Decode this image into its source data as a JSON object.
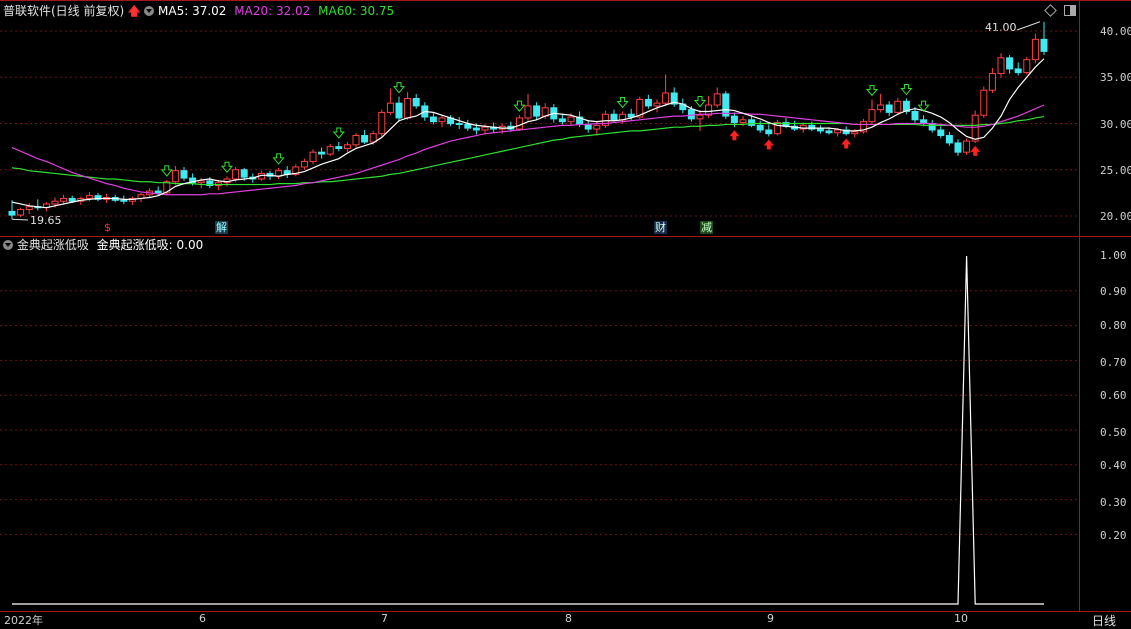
{
  "title": "普联软件(日线 前复权)",
  "ma": [
    {
      "label": "MA5: 37.02",
      "color": "#ffffff"
    },
    {
      "label": "MA20: 32.02",
      "color": "#e040e0"
    },
    {
      "label": "MA60: 30.75",
      "color": "#30e030"
    }
  ],
  "indicator": {
    "name": "金典起涨低吸",
    "value_label": "金典起涨低吸: 0.00"
  },
  "price_axis": [
    "40.00",
    "35.00",
    "30.00",
    "25.00",
    "20.00"
  ],
  "indicator_axis": [
    "1.00",
    "0.90",
    "0.80",
    "0.70",
    "0.60",
    "0.50",
    "0.40",
    "0.30",
    "0.20"
  ],
  "x_axis": [
    "2022年",
    "6",
    "7",
    "8",
    "9",
    "10"
  ],
  "period_label": "日线",
  "max_price_label": "41.00",
  "min_price_label": "19.65",
  "events": [
    {
      "label": "$",
      "color": "#ff3030",
      "bg": ""
    },
    {
      "label": "解",
      "color": "#9ff",
      "bg": "#1a3a4a"
    },
    {
      "label": "财",
      "color": "#cfe",
      "bg": "#1a2a4a"
    },
    {
      "label": "减",
      "color": "#cfc",
      "bg": "#1a4a1a"
    }
  ],
  "colors": {
    "up": "#ff4040",
    "down": "#40e8f0",
    "grid": "#6a1515",
    "frame": "#a01818"
  },
  "chart_data": [
    {
      "type": "candlestick",
      "title": "普联软件(日线 前复权)",
      "ylim": [
        18.5,
        42
      ],
      "ohlc": [
        [
          20.5,
          21.7,
          19.65,
          20.1
        ],
        [
          20.1,
          20.9,
          19.9,
          20.7
        ],
        [
          20.7,
          21.4,
          20.2,
          21.0
        ],
        [
          21.0,
          21.8,
          20.6,
          20.9
        ],
        [
          20.9,
          21.5,
          20.5,
          21.3
        ],
        [
          21.3,
          22.0,
          20.9,
          21.6
        ],
        [
          21.6,
          22.3,
          21.2,
          21.9
        ],
        [
          21.9,
          22.2,
          21.4,
          21.6
        ],
        [
          21.6,
          22.1,
          21.2,
          21.9
        ],
        [
          21.9,
          22.6,
          21.6,
          22.2
        ],
        [
          22.2,
          22.5,
          21.6,
          21.8
        ],
        [
          21.8,
          22.4,
          21.4,
          22.0
        ],
        [
          22.0,
          22.3,
          21.5,
          21.7
        ],
        [
          21.7,
          22.2,
          21.3,
          21.6
        ],
        [
          21.6,
          22.1,
          21.2,
          21.9
        ],
        [
          21.9,
          22.5,
          21.5,
          22.3
        ],
        [
          22.3,
          23.0,
          22.0,
          22.7
        ],
        [
          22.7,
          23.2,
          22.2,
          22.5
        ],
        [
          22.5,
          23.9,
          22.3,
          23.7
        ],
        [
          23.7,
          25.4,
          23.4,
          24.9
        ],
        [
          24.9,
          25.3,
          23.8,
          24.1
        ],
        [
          24.1,
          24.6,
          23.3,
          23.6
        ],
        [
          23.6,
          24.1,
          23.0,
          23.8
        ],
        [
          23.8,
          24.2,
          23.0,
          23.3
        ],
        [
          23.3,
          23.9,
          22.8,
          23.6
        ],
        [
          23.6,
          24.3,
          23.2,
          24.0
        ],
        [
          24.0,
          25.3,
          23.7,
          25.0
        ],
        [
          25.0,
          25.2,
          23.8,
          24.2
        ],
        [
          24.2,
          24.6,
          23.6,
          24.0
        ],
        [
          24.0,
          24.9,
          23.8,
          24.6
        ],
        [
          24.6,
          24.9,
          23.9,
          24.3
        ],
        [
          24.3,
          25.2,
          24.0,
          24.9
        ],
        [
          24.9,
          25.4,
          24.1,
          24.5
        ],
        [
          24.5,
          25.6,
          24.3,
          25.3
        ],
        [
          25.3,
          26.2,
          25.0,
          25.9
        ],
        [
          25.9,
          27.2,
          25.6,
          26.9
        ],
        [
          26.9,
          27.4,
          26.2,
          26.7
        ],
        [
          26.7,
          27.8,
          26.5,
          27.5
        ],
        [
          27.5,
          28.0,
          27.0,
          27.3
        ],
        [
          27.3,
          28.0,
          26.9,
          27.7
        ],
        [
          27.7,
          29.0,
          27.4,
          28.7
        ],
        [
          28.7,
          29.3,
          27.8,
          28.0
        ],
        [
          28.0,
          29.2,
          27.7,
          28.9
        ],
        [
          28.9,
          31.5,
          28.6,
          31.2
        ],
        [
          31.2,
          33.8,
          30.9,
          32.2
        ],
        [
          32.2,
          32.9,
          30.2,
          30.6
        ],
        [
          30.6,
          33.4,
          30.4,
          32.7
        ],
        [
          32.7,
          33.2,
          31.6,
          31.9
        ],
        [
          31.9,
          32.3,
          30.3,
          30.7
        ],
        [
          30.7,
          31.2,
          29.9,
          30.2
        ],
        [
          30.2,
          30.9,
          29.6,
          30.6
        ],
        [
          30.6,
          30.9,
          29.7,
          30.0
        ],
        [
          30.0,
          30.7,
          29.4,
          29.9
        ],
        [
          29.9,
          30.4,
          29.2,
          29.5
        ],
        [
          29.5,
          30.0,
          28.8,
          29.3
        ],
        [
          29.3,
          29.9,
          28.8,
          29.6
        ],
        [
          29.6,
          30.1,
          29.0,
          29.4
        ],
        [
          29.4,
          30.0,
          28.9,
          29.7
        ],
        [
          29.7,
          30.2,
          29.1,
          29.4
        ],
        [
          29.4,
          30.9,
          29.2,
          30.6
        ],
        [
          30.6,
          33.2,
          30.3,
          31.9
        ],
        [
          31.9,
          32.3,
          30.4,
          30.8
        ],
        [
          30.8,
          32.2,
          30.5,
          31.7
        ],
        [
          31.7,
          32.1,
          30.1,
          30.5
        ],
        [
          30.5,
          31.0,
          29.9,
          30.2
        ],
        [
          30.2,
          31.1,
          29.8,
          30.7
        ],
        [
          30.7,
          31.3,
          29.6,
          29.9
        ],
        [
          29.9,
          30.4,
          29.0,
          29.4
        ],
        [
          29.4,
          30.2,
          28.7,
          29.8
        ],
        [
          29.8,
          31.4,
          29.5,
          31.0
        ],
        [
          31.0,
          31.5,
          30.2,
          30.4
        ],
        [
          30.4,
          31.3,
          30.0,
          31.0
        ],
        [
          31.0,
          31.6,
          30.4,
          30.7
        ],
        [
          30.7,
          32.9,
          30.5,
          32.6
        ],
        [
          32.6,
          33.1,
          31.6,
          31.9
        ],
        [
          31.9,
          32.6,
          31.2,
          32.2
        ],
        [
          32.2,
          35.3,
          31.9,
          33.3
        ],
        [
          33.3,
          33.9,
          31.8,
          32.1
        ],
        [
          32.1,
          32.7,
          31.1,
          31.5
        ],
        [
          31.5,
          31.9,
          30.2,
          30.5
        ],
        [
          30.5,
          31.4,
          29.2,
          30.9
        ],
        [
          30.9,
          33.0,
          30.6,
          32.0
        ],
        [
          32.0,
          33.9,
          31.7,
          33.2
        ],
        [
          33.2,
          33.5,
          30.5,
          30.8
        ],
        [
          30.8,
          31.2,
          29.6,
          30.1
        ],
        [
          30.1,
          30.8,
          29.7,
          30.4
        ],
        [
          30.4,
          30.9,
          29.6,
          29.8
        ],
        [
          29.8,
          30.3,
          29.0,
          29.3
        ],
        [
          29.3,
          29.9,
          28.6,
          28.9
        ],
        [
          28.9,
          30.4,
          28.7,
          30.1
        ],
        [
          30.1,
          30.6,
          29.5,
          29.7
        ],
        [
          29.7,
          30.3,
          29.2,
          29.4
        ],
        [
          29.4,
          30.1,
          29.0,
          29.8
        ],
        [
          29.8,
          30.2,
          29.2,
          29.4
        ],
        [
          29.4,
          29.8,
          28.9,
          29.2
        ],
        [
          29.2,
          29.6,
          28.8,
          29.0
        ],
        [
          29.0,
          29.5,
          28.6,
          29.3
        ],
        [
          29.3,
          29.7,
          28.7,
          28.9
        ],
        [
          28.9,
          29.4,
          28.5,
          29.1
        ],
        [
          29.1,
          30.5,
          28.9,
          30.2
        ],
        [
          30.2,
          32.6,
          30.0,
          31.5
        ],
        [
          31.5,
          33.2,
          31.2,
          32.0
        ],
        [
          32.0,
          32.4,
          30.8,
          31.2
        ],
        [
          31.2,
          32.8,
          31.0,
          32.4
        ],
        [
          32.4,
          32.7,
          31.0,
          31.3
        ],
        [
          31.3,
          31.8,
          30.1,
          30.4
        ],
        [
          30.4,
          30.9,
          29.7,
          30.0
        ],
        [
          30.0,
          30.4,
          29.0,
          29.3
        ],
        [
          29.3,
          29.7,
          28.4,
          28.7
        ],
        [
          28.7,
          29.1,
          27.6,
          27.9
        ],
        [
          27.9,
          28.3,
          26.5,
          26.9
        ],
        [
          26.9,
          28.4,
          26.6,
          28.1
        ],
        [
          28.1,
          31.4,
          27.9,
          30.9
        ],
        [
          30.9,
          34.0,
          30.6,
          33.6
        ],
        [
          33.6,
          36.0,
          33.3,
          35.4
        ],
        [
          35.4,
          37.6,
          35.0,
          37.1
        ],
        [
          37.1,
          37.4,
          35.4,
          35.9
        ],
        [
          35.9,
          36.6,
          35.2,
          35.5
        ],
        [
          35.5,
          37.2,
          35.3,
          36.9
        ],
        [
          36.9,
          39.7,
          36.5,
          39.1
        ],
        [
          39.1,
          41.0,
          37.4,
          37.8
        ]
      ],
      "ma5": [
        21.5,
        21.3,
        21.1,
        21.0,
        20.9,
        21.1,
        21.3,
        21.5,
        21.7,
        21.8,
        21.9,
        21.9,
        21.9,
        21.8,
        21.8,
        21.9,
        22.0,
        22.2,
        22.6,
        23.2,
        23.5,
        23.7,
        23.9,
        24.0,
        23.8,
        23.7,
        23.9,
        24.0,
        24.1,
        24.4,
        24.4,
        24.3,
        24.5,
        24.6,
        24.8,
        25.2,
        25.6,
        25.9,
        26.2,
        26.8,
        27.3,
        27.6,
        27.9,
        28.5,
        29.4,
        30.3,
        30.6,
        30.8,
        31.3,
        31.2,
        30.9,
        30.6,
        30.3,
        30.0,
        29.8,
        29.7,
        29.6,
        29.5,
        29.5,
        29.8,
        30.2,
        30.4,
        30.8,
        31.1,
        31.0,
        30.9,
        30.6,
        30.3,
        30.2,
        30.3,
        30.3,
        30.4,
        30.6,
        30.9,
        31.3,
        31.7,
        32.0,
        32.3,
        32.1,
        31.6,
        31.3,
        31.3,
        31.4,
        31.5,
        31.4,
        31.1,
        30.8,
        30.5,
        30.1,
        29.8,
        29.7,
        29.6,
        29.5,
        29.5,
        29.5,
        29.5,
        29.4,
        29.2,
        29.2,
        29.3,
        29.6,
        30.1,
        30.5,
        31.0,
        31.4,
        31.6,
        31.4,
        31.1,
        30.7,
        30.1,
        29.3,
        28.6,
        28.3,
        28.5,
        29.5,
        30.8,
        32.6,
        33.9,
        35.0,
        36.1,
        37.0
      ],
      "ma20": [
        27.4,
        27.0,
        26.6,
        26.2,
        25.9,
        25.5,
        25.1,
        24.7,
        24.4,
        24.1,
        23.8,
        23.5,
        23.3,
        23.0,
        22.8,
        22.6,
        22.5,
        22.4,
        22.3,
        22.3,
        22.3,
        22.3,
        22.3,
        22.4,
        22.4,
        22.5,
        22.6,
        22.7,
        22.8,
        22.9,
        23.0,
        23.1,
        23.2,
        23.3,
        23.5,
        23.6,
        23.8,
        24.0,
        24.2,
        24.4,
        24.6,
        24.9,
        25.2,
        25.5,
        25.8,
        26.1,
        26.5,
        26.8,
        27.2,
        27.5,
        27.8,
        28.1,
        28.3,
        28.5,
        28.7,
        28.9,
        29.0,
        29.1,
        29.2,
        29.3,
        29.4,
        29.5,
        29.6,
        29.7,
        29.8,
        29.8,
        29.9,
        29.9,
        30.0,
        30.0,
        30.1,
        30.2,
        30.3,
        30.4,
        30.5,
        30.6,
        30.7,
        30.8,
        30.8,
        30.9,
        31.0,
        31.0,
        31.1,
        31.1,
        31.1,
        31.1,
        31.0,
        31.0,
        30.9,
        30.8,
        30.7,
        30.6,
        30.5,
        30.4,
        30.3,
        30.2,
        30.1,
        30.0,
        29.9,
        29.9,
        29.9,
        29.9,
        29.9,
        30.0,
        30.0,
        30.0,
        30.0,
        30.0,
        29.9,
        29.8,
        29.7,
        29.6,
        29.6,
        29.7,
        29.9,
        30.2,
        30.5,
        30.8,
        31.2,
        31.6,
        32.0
      ],
      "ma60": [
        25.2,
        25.1,
        24.9,
        24.8,
        24.7,
        24.6,
        24.5,
        24.4,
        24.3,
        24.2,
        24.1,
        24.0,
        24.0,
        23.9,
        23.8,
        23.7,
        23.7,
        23.6,
        23.6,
        23.5,
        23.5,
        23.5,
        23.4,
        23.4,
        23.4,
        23.4,
        23.4,
        23.4,
        23.4,
        23.4,
        23.4,
        23.5,
        23.5,
        23.5,
        23.6,
        23.6,
        23.7,
        23.7,
        23.8,
        23.9,
        24.0,
        24.1,
        24.2,
        24.3,
        24.5,
        24.6,
        24.8,
        25.0,
        25.2,
        25.4,
        25.6,
        25.8,
        26.0,
        26.2,
        26.4,
        26.6,
        26.8,
        27.0,
        27.2,
        27.4,
        27.6,
        27.8,
        28.0,
        28.2,
        28.3,
        28.5,
        28.6,
        28.7,
        28.8,
        28.9,
        29.0,
        29.1,
        29.2,
        29.2,
        29.3,
        29.4,
        29.5,
        29.6,
        29.6,
        29.7,
        29.7,
        29.8,
        29.8,
        29.9,
        29.9,
        29.9,
        30.0,
        30.0,
        30.0,
        30.0,
        30.0,
        30.0,
        30.0,
        30.0,
        30.0,
        30.0,
        30.0,
        30.0,
        29.9,
        29.9,
        29.9,
        29.9,
        29.9,
        29.9,
        29.9,
        29.9,
        29.8,
        29.8,
        29.8,
        29.8,
        29.8,
        29.8,
        29.8,
        29.9,
        29.9,
        30.0,
        30.1,
        30.3,
        30.4,
        30.6,
        30.75
      ]
    },
    {
      "type": "line",
      "title": "金典起涨低吸",
      "ylim": [
        0,
        1
      ],
      "values": [
        0,
        0,
        0,
        0,
        0,
        0,
        0,
        0,
        0,
        0,
        0,
        0,
        0,
        0,
        0,
        0,
        0,
        0,
        0,
        0,
        0,
        0,
        0,
        0,
        0,
        0,
        0,
        0,
        0,
        0,
        0,
        0,
        0,
        0,
        0,
        0,
        0,
        0,
        0,
        0,
        0,
        0,
        0,
        0,
        0,
        0,
        0,
        0,
        0,
        0,
        0,
        0,
        0,
        0,
        0,
        0,
        0,
        0,
        0,
        0,
        0,
        0,
        0,
        0,
        0,
        0,
        0,
        0,
        0,
        0,
        0,
        0,
        0,
        0,
        0,
        0,
        0,
        0,
        0,
        0,
        0,
        0,
        0,
        0,
        0,
        0,
        0,
        0,
        0,
        0,
        0,
        0,
        0,
        0,
        0,
        0,
        0,
        0,
        0,
        0,
        0,
        0,
        0,
        0,
        0,
        0,
        0,
        0,
        0,
        0,
        0,
        1,
        0,
        0,
        0,
        0,
        0,
        0,
        0,
        0,
        0
      ]
    }
  ]
}
